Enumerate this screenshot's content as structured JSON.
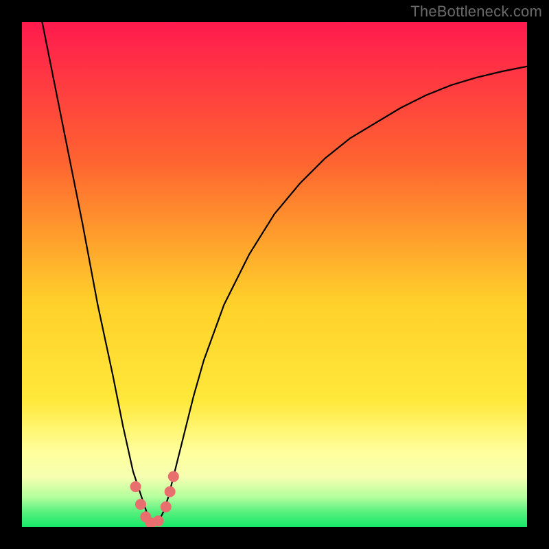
{
  "watermark": "TheBottleneck.com",
  "chart_data": {
    "type": "line",
    "title": "",
    "xlabel": "",
    "ylabel": "",
    "xlim": [
      0,
      100
    ],
    "ylim": [
      0,
      100
    ],
    "grid": false,
    "legend": false,
    "curve": {
      "description": "Bottleneck percentage curve with minimum near x≈26",
      "x": [
        0,
        4,
        8,
        12,
        15,
        18,
        20,
        22,
        24,
        25,
        26,
        27,
        28,
        29,
        30,
        32,
        34,
        36,
        40,
        45,
        50,
        55,
        60,
        65,
        70,
        75,
        80,
        85,
        90,
        95,
        100
      ],
      "y": [
        120,
        100,
        80,
        60,
        44,
        30,
        20,
        11,
        5,
        2,
        0.5,
        1,
        3,
        6,
        10,
        18,
        26,
        33,
        44,
        54,
        62,
        68,
        73,
        77,
        80,
        83,
        85.5,
        87.5,
        89,
        90.2,
        91.2
      ]
    },
    "markers": {
      "description": "Recommended range markers near minimum",
      "color": "#e96f6f",
      "points": [
        {
          "x": 22.5,
          "y": 8
        },
        {
          "x": 23.5,
          "y": 4.5
        },
        {
          "x": 24.5,
          "y": 2
        },
        {
          "x": 25.5,
          "y": 0.8
        },
        {
          "x": 27.0,
          "y": 1.2
        },
        {
          "x": 28.5,
          "y": 4
        },
        {
          "x": 29.3,
          "y": 7
        },
        {
          "x": 30.0,
          "y": 10
        }
      ]
    },
    "background_gradient": {
      "top": "#ff1a4e",
      "mid1": "#ff7d2e",
      "mid2": "#ffcf2a",
      "pale": "#ffff9c",
      "green": "#17e86a"
    }
  },
  "colors": {
    "frame": "#000000",
    "curve": "#000000",
    "marker": "#e96f6f",
    "watermark": "#6a6a6a"
  }
}
